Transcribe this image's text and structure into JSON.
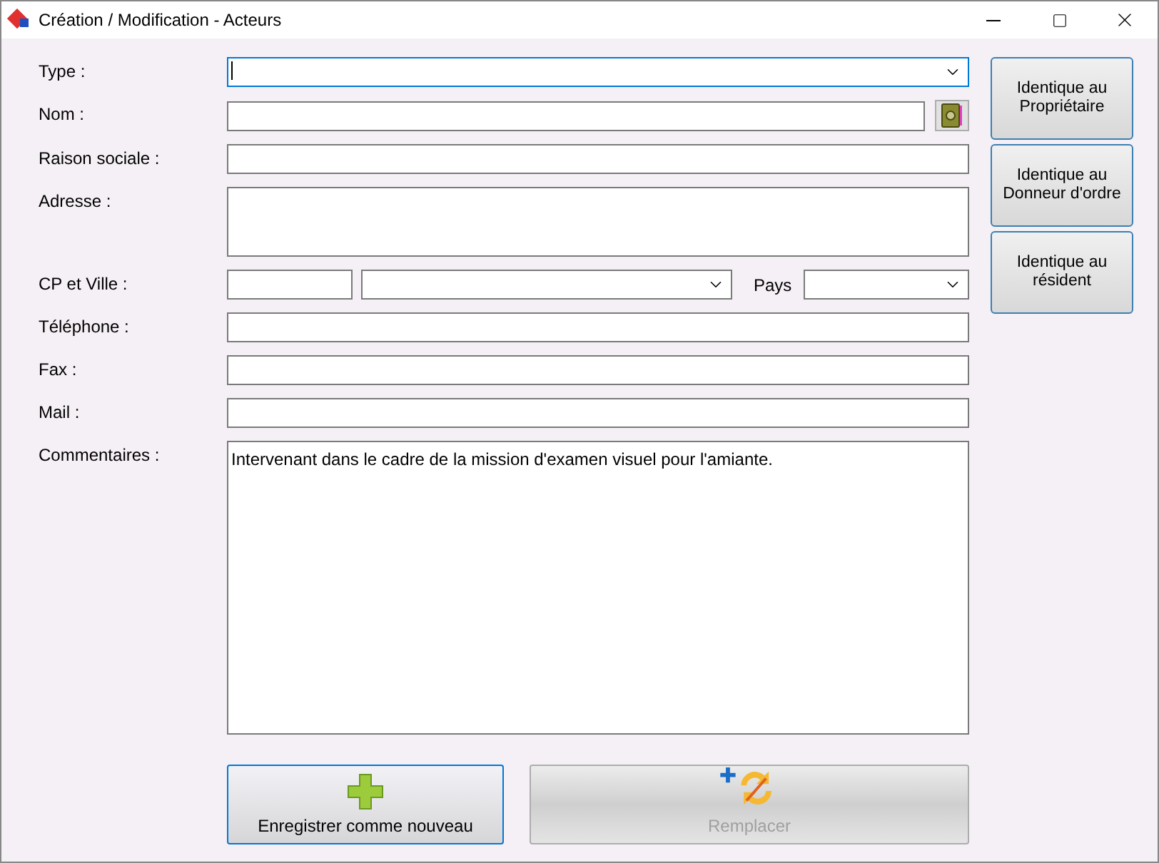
{
  "window": {
    "title": "Création / Modification - Acteurs"
  },
  "fields": [
    {
      "label": "Type :",
      "kind": "combo",
      "focused": true
    },
    {
      "label": "Nom :",
      "kind": "text_with_book",
      "focused": false
    },
    {
      "label": "Raison sociale :",
      "kind": "text",
      "focused": false
    },
    {
      "label": "Adresse :",
      "kind": "multiline",
      "focused": false
    },
    {
      "label": "CP et Ville :",
      "kind": "cp_ville",
      "country_label": "Pays",
      "focused": false
    },
    {
      "label": "Téléphone :",
      "kind": "text",
      "focused": false
    },
    {
      "label": "Fax :",
      "kind": "text",
      "focused": false
    },
    {
      "label": "Mail :",
      "kind": "text",
      "focused": false
    },
    {
      "label": "Commentaires :",
      "kind": "comments",
      "value": "Intervenant dans le cadre de la mission d'examen visuel pour l'amiante.",
      "focused": false
    }
  ],
  "side_buttons": [
    "Identique au Propriétaire",
    "Identique au Donneur d'ordre",
    "Identique au résident"
  ],
  "bottom_buttons": [
    {
      "label": "Enregistrer comme nouveau",
      "kind": "add",
      "disabled": false
    },
    {
      "label": "Remplacer",
      "kind": "replace",
      "disabled": true
    }
  ]
}
